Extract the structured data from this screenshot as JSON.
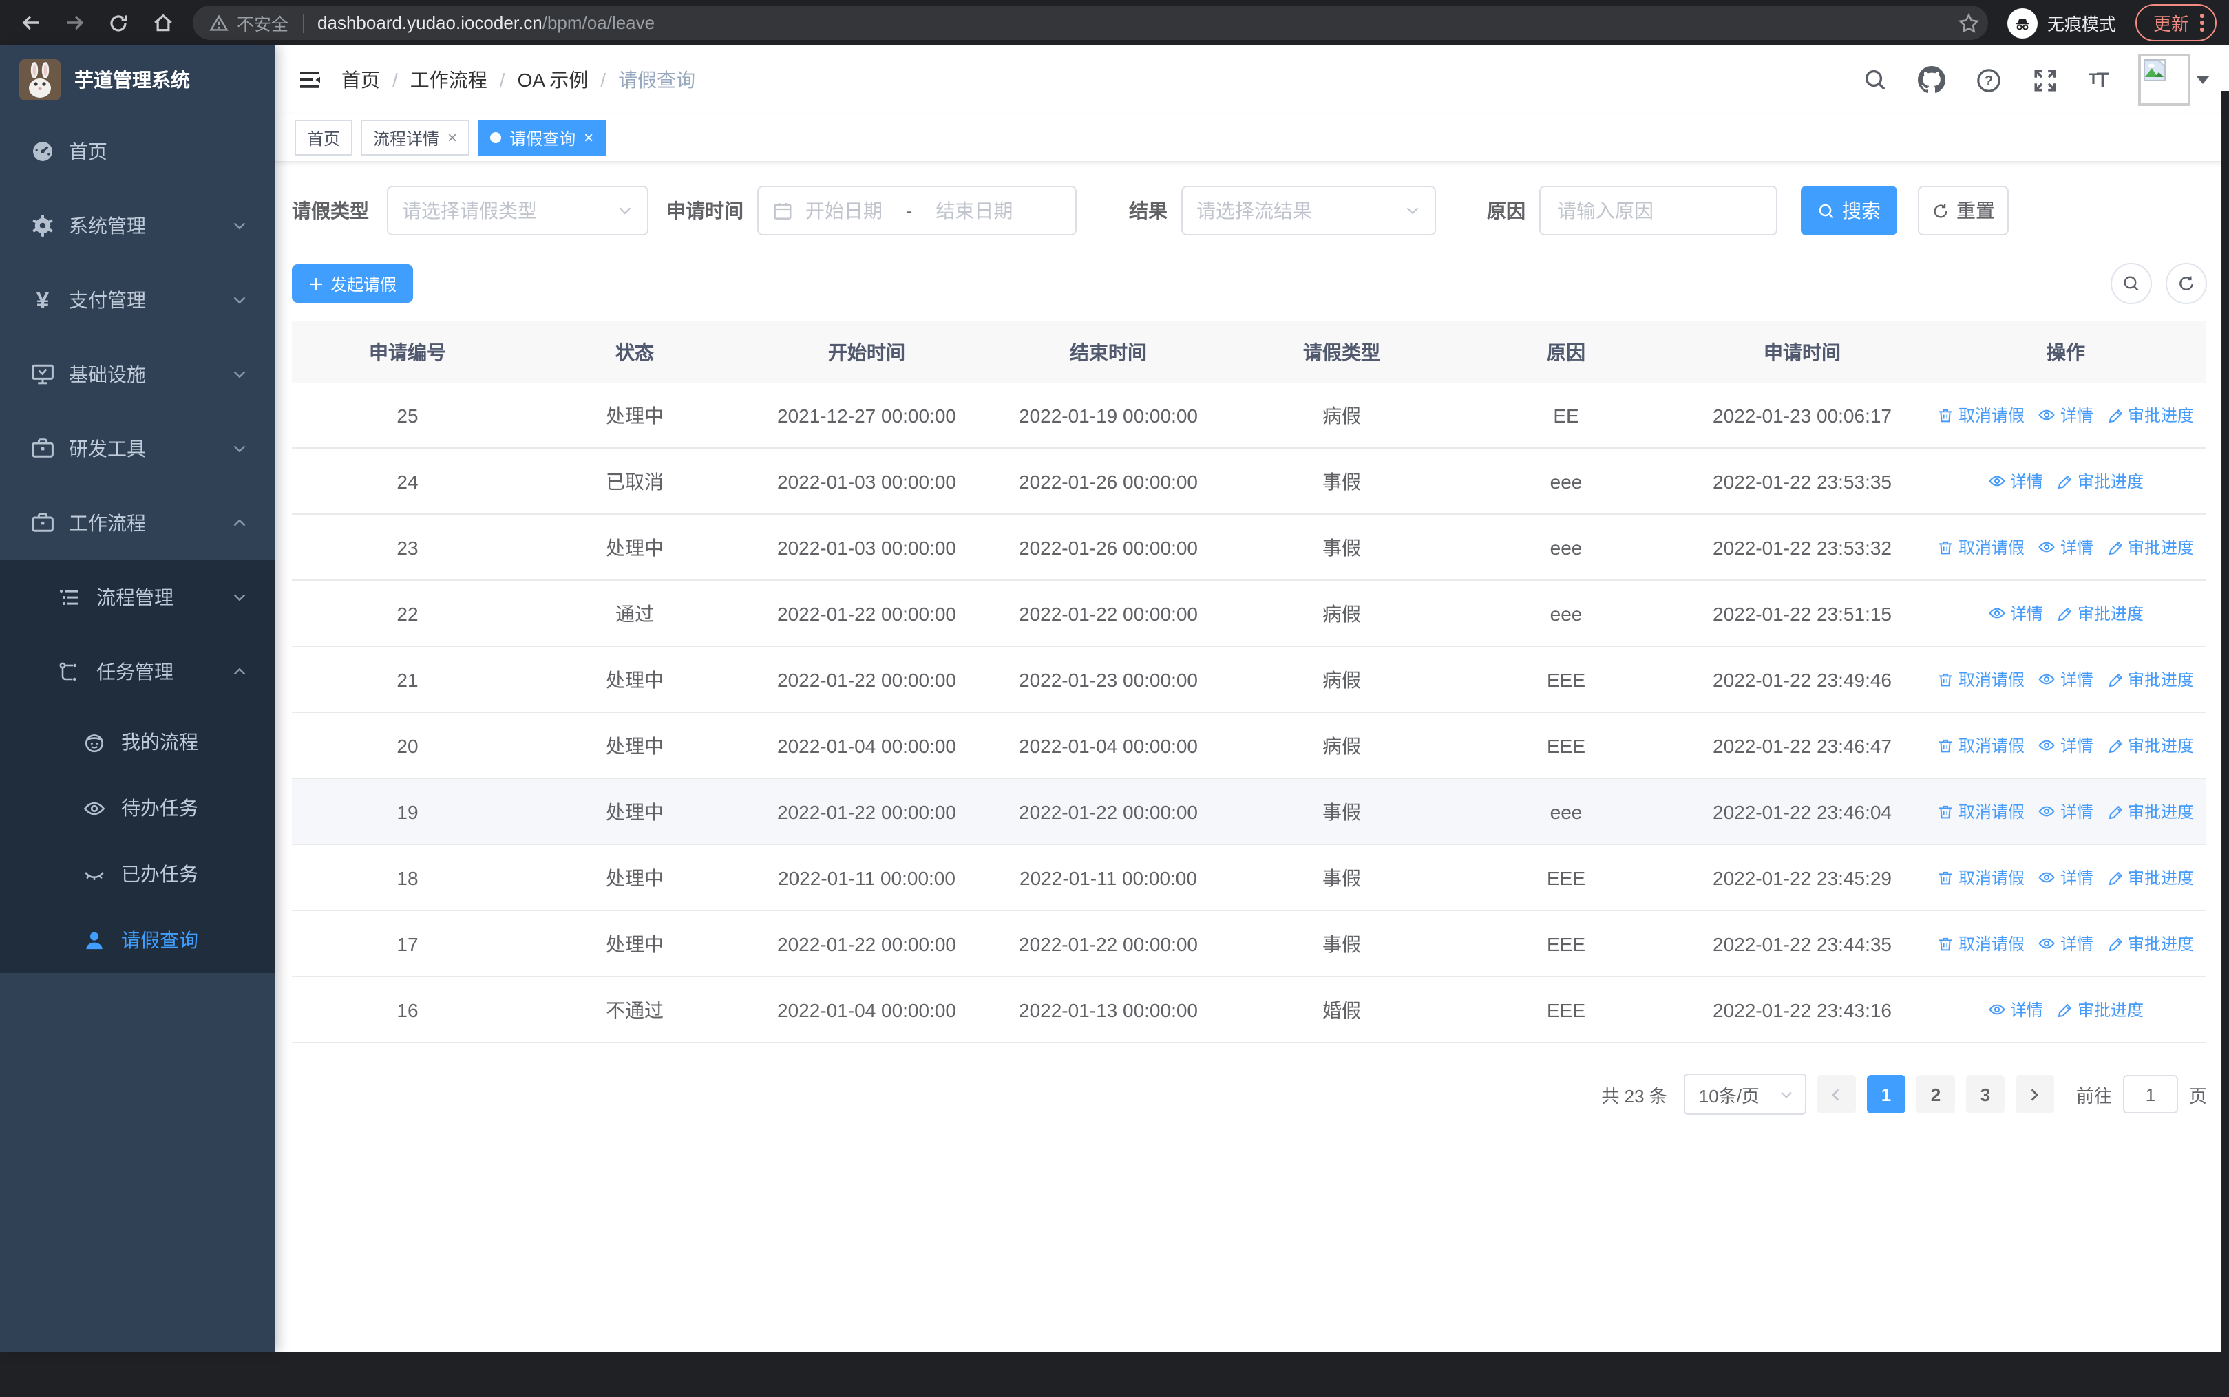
{
  "browser": {
    "security_label": "不安全",
    "url_host": "dashboard.yudao.iocoder.cn",
    "url_path": "/bpm/oa/leave",
    "incognito_label": "无痕模式",
    "update_label": "更新"
  },
  "sidebar": {
    "title": "芋道管理系统",
    "items": [
      {
        "label": "首页"
      },
      {
        "label": "系统管理"
      },
      {
        "label": "支付管理"
      },
      {
        "label": "基础设施"
      },
      {
        "label": "研发工具"
      },
      {
        "label": "工作流程"
      },
      {
        "label": "流程管理"
      },
      {
        "label": "任务管理"
      },
      {
        "label": "我的流程"
      },
      {
        "label": "待办任务"
      },
      {
        "label": "已办任务"
      },
      {
        "label": "请假查询"
      }
    ]
  },
  "breadcrumb": [
    "首页",
    "工作流程",
    "OA 示例",
    "请假查询"
  ],
  "tabs": [
    {
      "label": "首页"
    },
    {
      "label": "流程详情"
    },
    {
      "label": "请假查询"
    }
  ],
  "filters": {
    "type_label": "请假类型",
    "type_placeholder": "请选择请假类型",
    "time_label": "申请时间",
    "start_placeholder": "开始日期",
    "range_separator": "-",
    "end_placeholder": "结束日期",
    "result_label": "结果",
    "result_placeholder": "请选择流结果",
    "reason_label": "原因",
    "reason_placeholder": "请输入原因",
    "search_label": "搜索",
    "reset_label": "重置"
  },
  "toolbar": {
    "create_label": "发起请假"
  },
  "table": {
    "columns": [
      "申请编号",
      "状态",
      "开始时间",
      "结束时间",
      "请假类型",
      "原因",
      "申请时间",
      "操作"
    ],
    "action_labels": {
      "cancel": "取消请假",
      "detail": "详情",
      "progress": "审批进度"
    },
    "highlighted_id": "19",
    "rows": [
      {
        "id": "25",
        "status": "处理中",
        "start": "2021-12-27 00:00:00",
        "end": "2022-01-19 00:00:00",
        "type": "病假",
        "reason": "EE",
        "applied": "2022-01-23 00:06:17",
        "actions": [
          "cancel",
          "detail",
          "progress"
        ]
      },
      {
        "id": "24",
        "status": "已取消",
        "start": "2022-01-03 00:00:00",
        "end": "2022-01-26 00:00:00",
        "type": "事假",
        "reason": "eee",
        "applied": "2022-01-22 23:53:35",
        "actions": [
          "detail",
          "progress"
        ]
      },
      {
        "id": "23",
        "status": "处理中",
        "start": "2022-01-03 00:00:00",
        "end": "2022-01-26 00:00:00",
        "type": "事假",
        "reason": "eee",
        "applied": "2022-01-22 23:53:32",
        "actions": [
          "cancel",
          "detail",
          "progress"
        ]
      },
      {
        "id": "22",
        "status": "通过",
        "start": "2022-01-22 00:00:00",
        "end": "2022-01-22 00:00:00",
        "type": "病假",
        "reason": "eee",
        "applied": "2022-01-22 23:51:15",
        "actions": [
          "detail",
          "progress"
        ]
      },
      {
        "id": "21",
        "status": "处理中",
        "start": "2022-01-22 00:00:00",
        "end": "2022-01-23 00:00:00",
        "type": "病假",
        "reason": "EEE",
        "applied": "2022-01-22 23:49:46",
        "actions": [
          "cancel",
          "detail",
          "progress"
        ]
      },
      {
        "id": "20",
        "status": "处理中",
        "start": "2022-01-04 00:00:00",
        "end": "2022-01-04 00:00:00",
        "type": "病假",
        "reason": "EEE",
        "applied": "2022-01-22 23:46:47",
        "actions": [
          "cancel",
          "detail",
          "progress"
        ]
      },
      {
        "id": "19",
        "status": "处理中",
        "start": "2022-01-22 00:00:00",
        "end": "2022-01-22 00:00:00",
        "type": "事假",
        "reason": "eee",
        "applied": "2022-01-22 23:46:04",
        "actions": [
          "cancel",
          "detail",
          "progress"
        ]
      },
      {
        "id": "18",
        "status": "处理中",
        "start": "2022-01-11 00:00:00",
        "end": "2022-01-11 00:00:00",
        "type": "事假",
        "reason": "EEE",
        "applied": "2022-01-22 23:45:29",
        "actions": [
          "cancel",
          "detail",
          "progress"
        ]
      },
      {
        "id": "17",
        "status": "处理中",
        "start": "2022-01-22 00:00:00",
        "end": "2022-01-22 00:00:00",
        "type": "事假",
        "reason": "EEE",
        "applied": "2022-01-22 23:44:35",
        "actions": [
          "cancel",
          "detail",
          "progress"
        ]
      },
      {
        "id": "16",
        "status": "不通过",
        "start": "2022-01-04 00:00:00",
        "end": "2022-01-13 00:00:00",
        "type": "婚假",
        "reason": "EEE",
        "applied": "2022-01-22 23:43:16",
        "actions": [
          "detail",
          "progress"
        ]
      }
    ]
  },
  "pagination": {
    "total_label": "共 23 条",
    "page_size_label": "10条/页",
    "pages": [
      "1",
      "2",
      "3"
    ],
    "active_page": "1",
    "goto_label": "前往",
    "goto_value": "1",
    "goto_suffix": "页"
  },
  "colors": {
    "accent": "#409eff",
    "sidebar_bg": "#304156",
    "submenu_bg": "#1f2d3d",
    "link_blue": "#459bfa",
    "update_red": "#f28b82"
  }
}
